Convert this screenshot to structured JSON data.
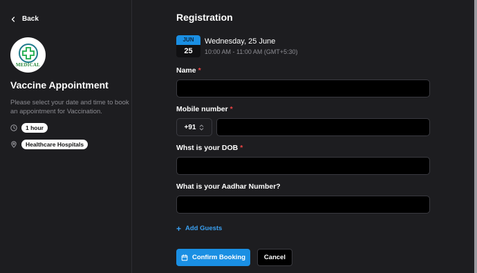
{
  "sidebar": {
    "back_label": "Back",
    "logo_text": "MEDICAL",
    "event_title": "Vaccine Appointment",
    "description": "Please select your date and time to book an appointment for Vaccination.",
    "duration": "1 hour",
    "location": "Healthcare Hospitals"
  },
  "main": {
    "title": "Registration",
    "calendar": {
      "month": "JUN",
      "day": "25"
    },
    "date": "Wednesday, 25 June",
    "time": "10:00 AM - 11:00 AM (GMT+5:30)",
    "fields": {
      "name": {
        "label": "Name",
        "required": "*",
        "value": ""
      },
      "mobile": {
        "label": "Mobile number",
        "required": "*",
        "country_code": "+91",
        "value": ""
      },
      "dob": {
        "label": "Whst is your DOB",
        "required": "*",
        "value": ""
      },
      "aadhar": {
        "label": "What is your Aadhar Number?",
        "value": ""
      }
    },
    "add_guests_label": "Add Guests",
    "confirm_label": "Confirm Booking",
    "cancel_label": "Cancel"
  },
  "colors": {
    "accent": "#1a8fe3",
    "required": "#ef4444",
    "background": "#1d1d20"
  },
  "icons": {
    "back": "chevron-left-icon",
    "clock": "clock-icon",
    "location": "map-pin-icon",
    "select": "chevron-up-down-icon",
    "add": "plus-icon",
    "calendar": "calendar-icon"
  }
}
